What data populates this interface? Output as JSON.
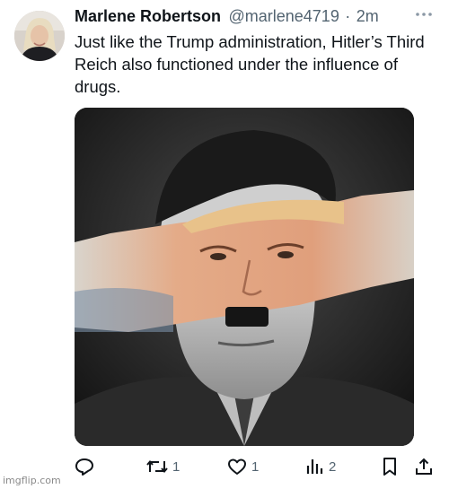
{
  "user": {
    "display_name": "Marlene Robertson",
    "handle": "@marlene4719",
    "separator": "·",
    "timestamp": "2m",
    "avatar_icon": "avatar-photo"
  },
  "tweet": {
    "text": "Just like the Trump administration, Hitler’s Third Reich also functioned under the influence of drugs.",
    "media_icon": "photo-collage"
  },
  "actions": {
    "reply_icon": "reply-icon",
    "retweet_icon": "retweet-icon",
    "retweet_count": "1",
    "like_icon": "heart-icon",
    "like_count": "1",
    "views_icon": "views-icon",
    "views_count": "2",
    "bookmark_icon": "bookmark-icon",
    "share_icon": "share-icon"
  },
  "watermark": "imgflip.com",
  "colors": {
    "text_primary": "#0f1419",
    "text_secondary": "#536471",
    "background": "#ffffff"
  }
}
